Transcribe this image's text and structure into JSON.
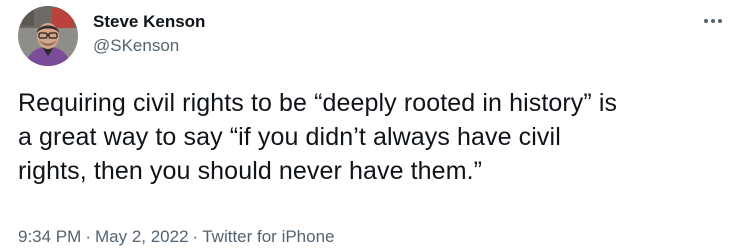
{
  "author": {
    "display_name": "Steve Kenson",
    "handle": "@SKenson"
  },
  "tweet": {
    "text_lines": [
      "Requiring civil rights to be “deeply rooted in history” is",
      "a great way to say “if you didn’t always have civil",
      "rights, then you should never have them.”"
    ]
  },
  "meta": {
    "time": "9:34 PM",
    "date": "May 2, 2022",
    "source": "Twitter for iPhone",
    "separator": "·"
  },
  "icons": {
    "more": "more-options-icon",
    "avatar": "profile-photo"
  },
  "colors": {
    "text": "#0f1419",
    "secondary": "#536471",
    "background": "#ffffff"
  }
}
